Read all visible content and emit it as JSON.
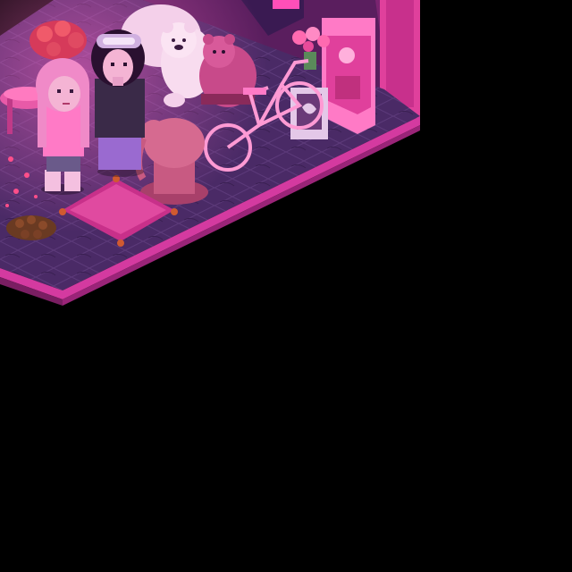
{
  "colors": {
    "background": "#000000",
    "floor_top": "#4a2a66",
    "floor_edge": "#b02a8a",
    "floor_rim": "#d43aa0",
    "wall_back": "#5a1e5e",
    "wall_pink": "#e0409c",
    "rug": "#6a2a7a",
    "glow": "#ff4fb8"
  },
  "scene": {
    "room": "isometric-room-corner",
    "avatars": [
      {
        "id": "avatar-girl",
        "hair": "#f08ac8",
        "outfit": "#ff7ac6"
      },
      {
        "id": "avatar-dark-hair",
        "hair": "#2a1030",
        "outfit": "#3a2a48"
      }
    ],
    "furniture": [
      "teddy-bear-white",
      "teddy-bear-pink",
      "bicycle",
      "elephant-statue",
      "floor-cushion",
      "pink-chair",
      "rose-bouquet",
      "arcade-cabinet",
      "picture-frame",
      "pinecone-pile"
    ]
  }
}
